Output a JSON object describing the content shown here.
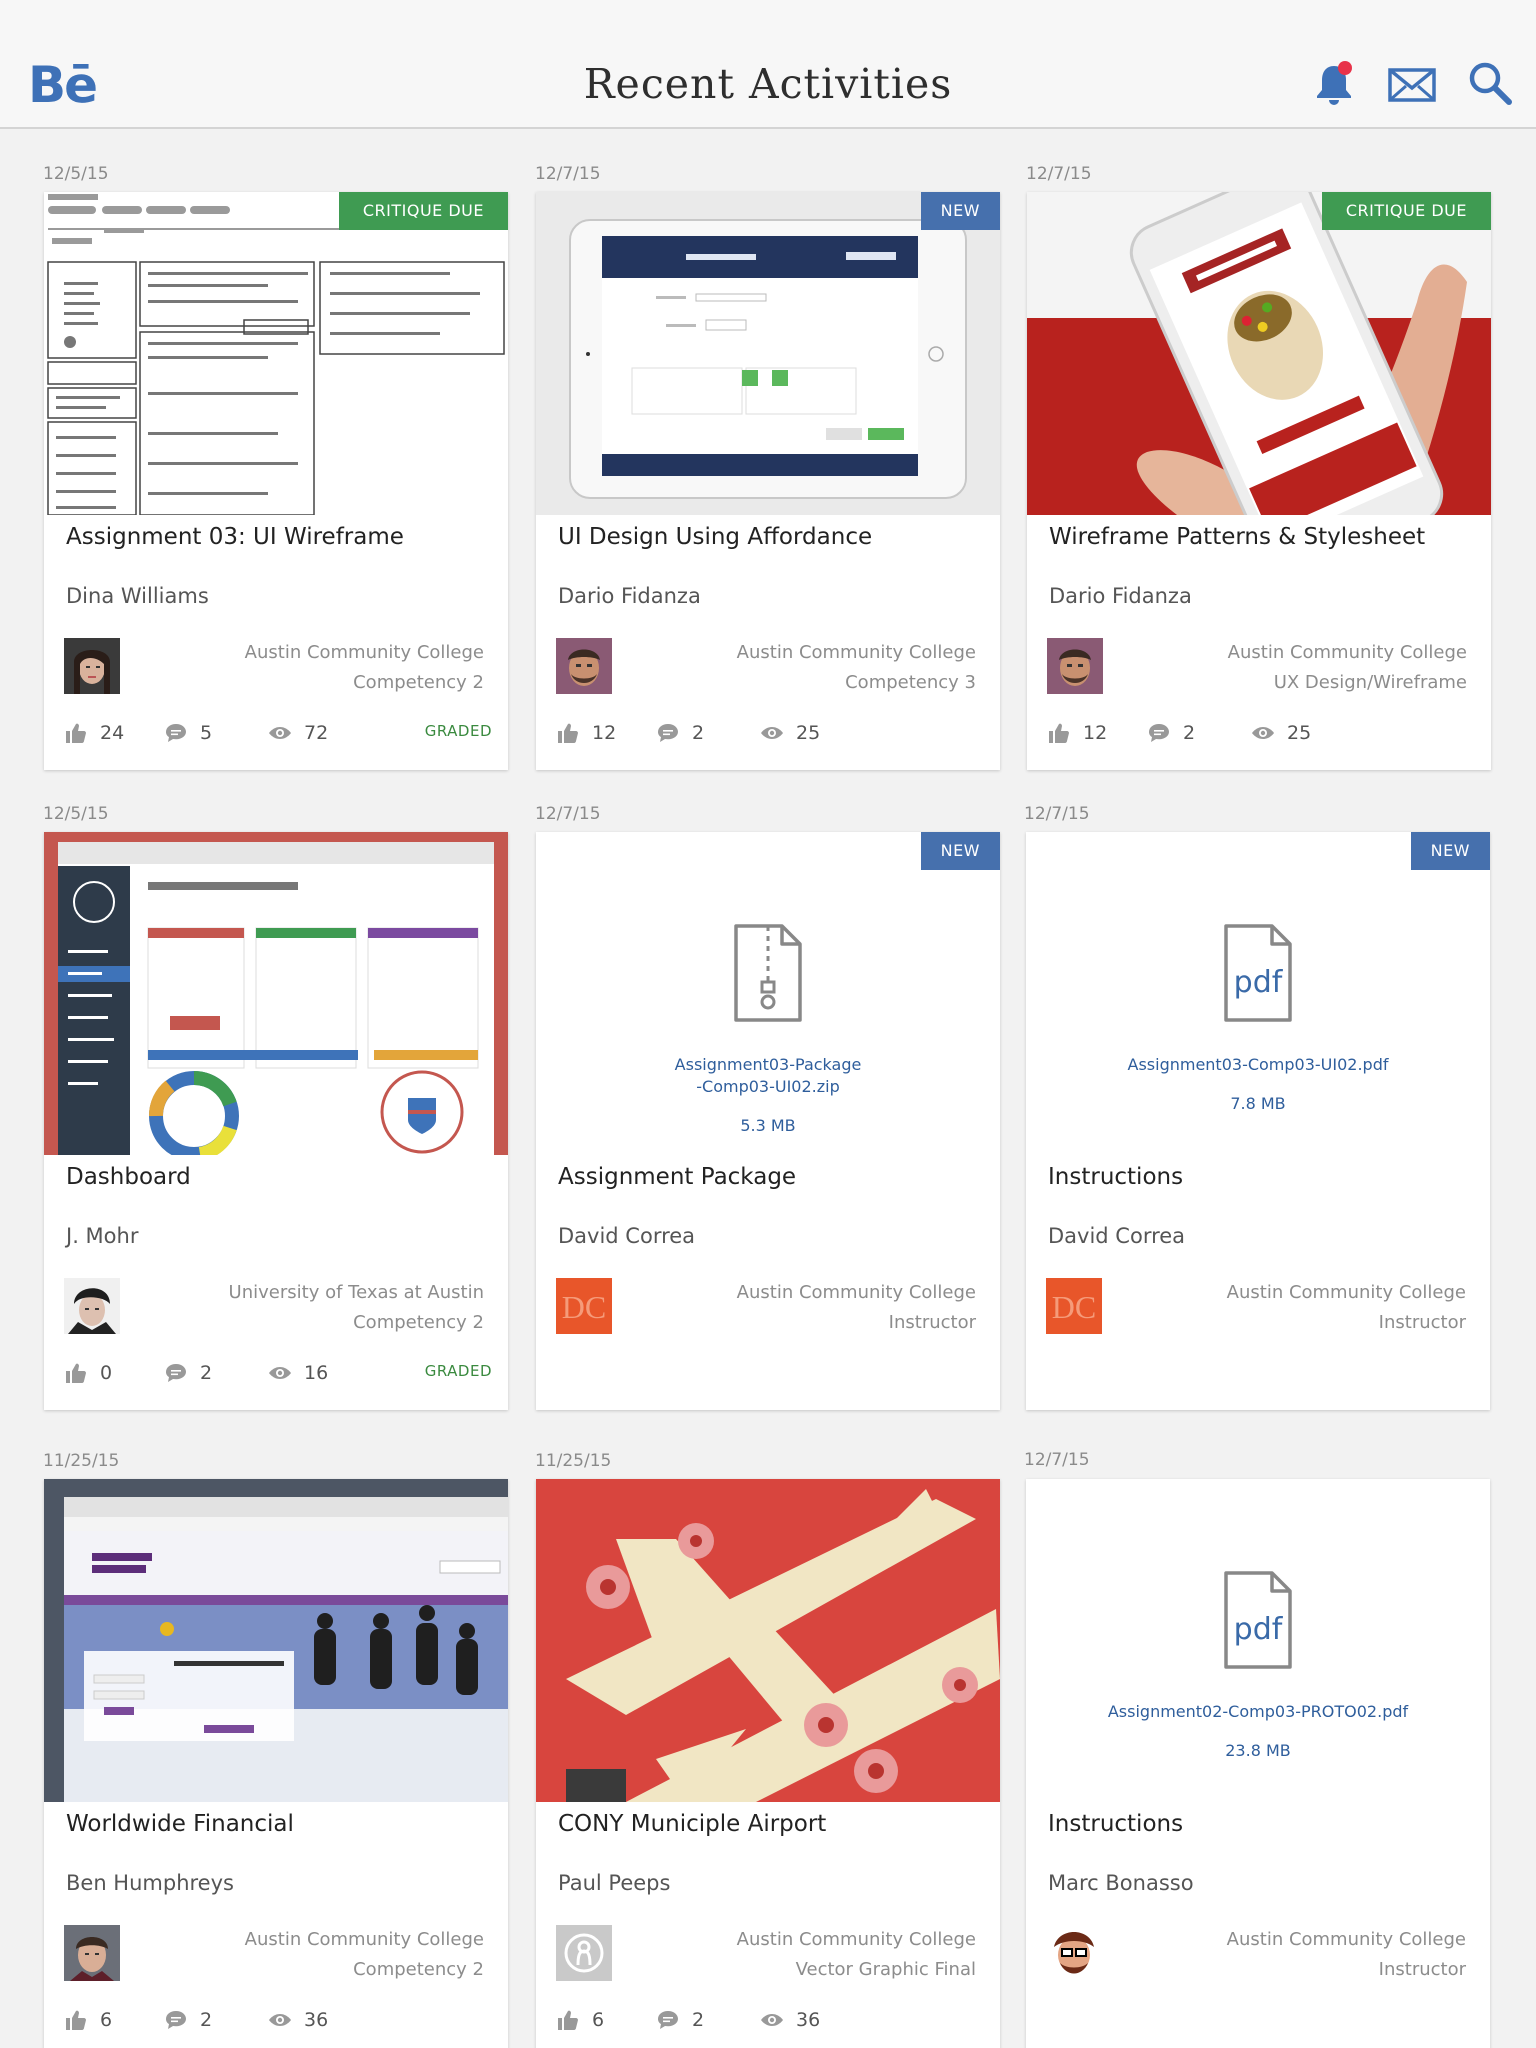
{
  "header": {
    "logo": "Bē",
    "title": "Recent Activities",
    "icons": [
      "bell-icon",
      "mail-icon",
      "search-icon"
    ],
    "notification_color": "#e8334a"
  },
  "colors": {
    "accent": "#3e71b7",
    "critique": "#3f9b52",
    "new": "#4670ad",
    "graded": "#3a8a3f"
  },
  "cards": [
    {
      "date": "12/5/15",
      "badge": "CRITIQUE DUE",
      "title": "Assignment 03: UI Wireframe",
      "author": "Dina Williams",
      "school": "Austin Community College",
      "course": "Competency 2",
      "likes": "24",
      "comments": "5",
      "views": "72",
      "status": "GRADED"
    },
    {
      "date": "12/7/15",
      "badge": "NEW",
      "title": "UI Design Using Affordance",
      "author": "Dario Fidanza",
      "school": "Austin Community College",
      "course": "Competency 3",
      "likes": "12",
      "comments": "2",
      "views": "25",
      "status": ""
    },
    {
      "date": "12/7/15",
      "badge": "CRITIQUE DUE",
      "title": "Wireframe Patterns & Stylesheet",
      "author": "Dario Fidanza",
      "school": "Austin Community College",
      "course": "UX Design/Wireframe",
      "likes": "12",
      "comments": "2",
      "views": "25",
      "status": ""
    },
    {
      "date": "12/5/15",
      "badge": "",
      "title": "Dashboard",
      "author": "J. Mohr",
      "school": "University of Texas at Austin",
      "course": "Competency 2",
      "likes": "0",
      "comments": "2",
      "views": "16",
      "status": "GRADED"
    },
    {
      "date": "12/7/15",
      "badge": "NEW",
      "title": "Assignment Package",
      "author": "David Correa",
      "school": "Austin Community College",
      "course": "Instructor",
      "file_name": "Assignment03-Package\n-Comp03-UI02.zip",
      "file_name_l1": "Assignment03-Package",
      "file_name_l2": "-Comp03-UI02.zip",
      "file_size": "5.3 MB",
      "file_icon": "zip-file-icon"
    },
    {
      "date": "12/7/15",
      "badge": "NEW",
      "title": "Instructions",
      "author": "David Correa",
      "school": "Austin Community College",
      "course": "Instructor",
      "file_name": "Assignment03-Comp03-UI02.pdf",
      "file_size": "7.8 MB",
      "file_icon": "pdf-file-icon",
      "file_icon_text": "pdf"
    },
    {
      "date": "11/25/15",
      "badge": "",
      "title": "Worldwide Financial",
      "author": "Ben Humphreys",
      "school": "Austin Community College",
      "course": "Competency 2",
      "likes": "6",
      "comments": "2",
      "views": "36",
      "status": ""
    },
    {
      "date": "11/25/15",
      "badge": "",
      "title": "CONY Municiple Airport",
      "author": "Paul Peeps",
      "school": "Austin Community College",
      "course": "Vector Graphic Final",
      "likes": "6",
      "comments": "2",
      "views": "36",
      "status": ""
    },
    {
      "date": "12/7/15",
      "badge": "",
      "title": "Instructions",
      "author": "Marc Bonasso",
      "school": "Austin Community College",
      "course": "Instructor",
      "file_name": "Assignment02-Comp03-PROTO02.pdf",
      "file_size": "23.8 MB",
      "file_icon": "pdf-file-icon",
      "file_icon_text": "pdf"
    }
  ]
}
